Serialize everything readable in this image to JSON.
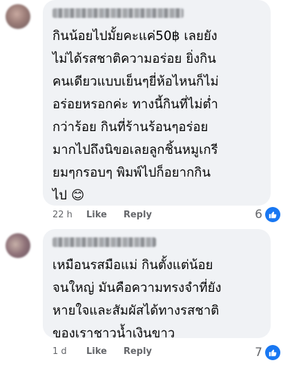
{
  "comments": [
    {
      "text": "กินน้อยไปมั้ยคะแค่50฿ เลยยัง\nไม่ได้รสชาติความอร่อย ยิ่งกิน\nคนเดียวแบบเย็นๆยี่ห้อไหนก็ไม่\nอร่อยหรอกค่ะ ทางนี้กินที่ไม่ต่ำ\nกว่าร้อย กินที่ร้านร้อนๆอร่อย\nมากไปถึงนิขอเลยลูกชิ้นหมูเกรี\nยมๆกรอบๆ พิมพ์ไปก็อยากกิน\nไป",
      "emoji": "😊",
      "time": "22 h",
      "like_label": "Like",
      "reply_label": "Reply",
      "reaction_count": "6",
      "reaction_icon": "like-icon"
    },
    {
      "text": "เหมือนรสมือแม่ กินตั้งแต่น้อย\nจนใหญ่ มันคือความทรงจำที่ยัง\nหายใจและสัมผัสได้ทางรสชาติ\nของเราชาวน้ำเงินขาว",
      "time": "1 d",
      "like_label": "Like",
      "reply_label": "Reply",
      "reaction_count": "7",
      "reaction_icon": "like-icon"
    }
  ],
  "colors": {
    "bubble": "#f0f2f5",
    "meta_text": "#65676b",
    "like_blue": "#1877f2"
  }
}
